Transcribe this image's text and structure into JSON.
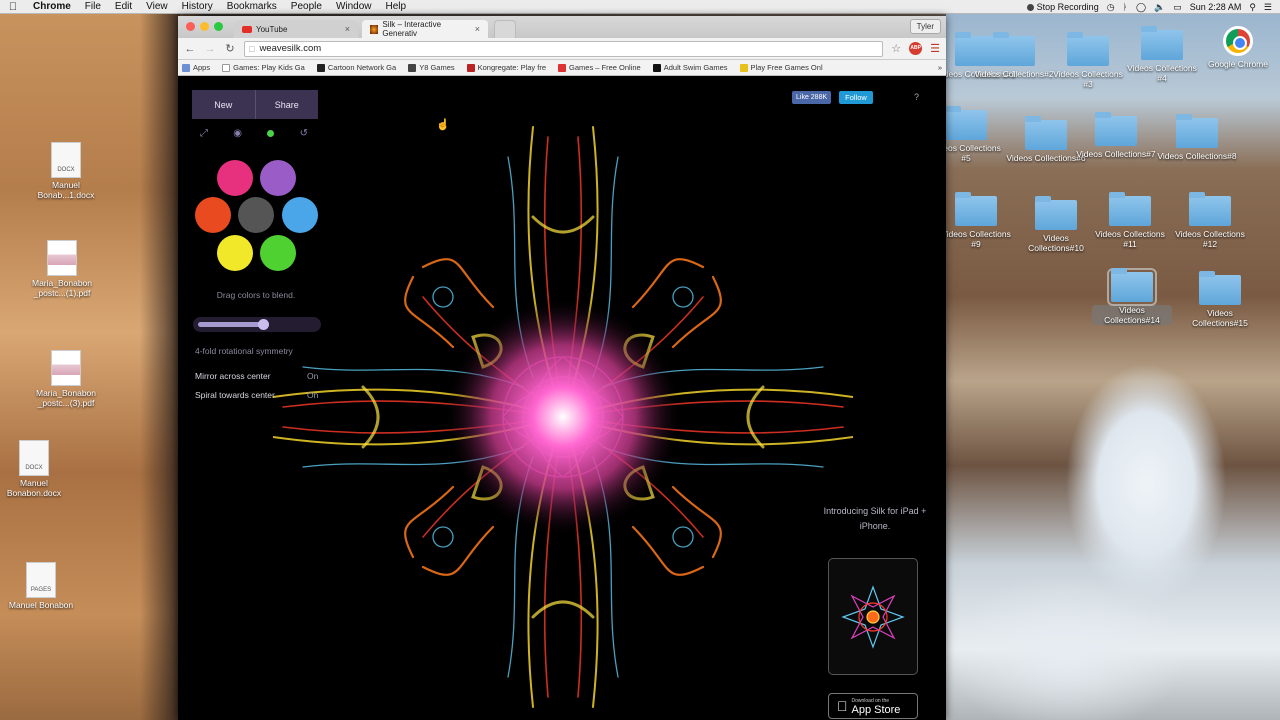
{
  "menubar": {
    "app": "Chrome",
    "items": [
      "File",
      "Edit",
      "View",
      "History",
      "Bookmarks",
      "People",
      "Window",
      "Help"
    ],
    "status": "Stop Recording",
    "clock": "Sun 2:28 AM"
  },
  "desktop": {
    "left_files": [
      {
        "label": "Manuel Bonab...1.docx",
        "type": "DOCX"
      },
      {
        "label": "Maria_Bonabon _postc...(1).pdf",
        "type": ""
      },
      {
        "label": "Maria_Bonabon _postc...(3).pdf",
        "type": ""
      },
      {
        "label": "Manuel Bonabon.docx",
        "type": "DOCX"
      },
      {
        "label": "Manuel Bonabon",
        "type": "PAGES"
      }
    ],
    "folders": [
      {
        "label": "Videos Collections#1"
      },
      {
        "label": "Videos Collections#2"
      },
      {
        "label": "Videos Collections #3"
      },
      {
        "label": "Videos Collections #4"
      },
      {
        "label": "Videos Collections #5"
      },
      {
        "label": "Videos Collections#6"
      },
      {
        "label": "Videos Collections#7"
      },
      {
        "label": "Videos Collections#8"
      },
      {
        "label": "Videos Collections #9"
      },
      {
        "label": "Videos Collections#10"
      },
      {
        "label": "Videos Collections #11"
      },
      {
        "label": "Videos Collections #12"
      },
      {
        "label": "Videos Collections#14"
      },
      {
        "label": "Videos Collections#15"
      }
    ],
    "chrome_icon_label": "Google Chrome"
  },
  "browser": {
    "tabs": [
      {
        "title": "YouTube"
      },
      {
        "title": "Silk – Interactive Generativ"
      }
    ],
    "profile": "Tyler",
    "url": "weavesilk.com",
    "bookmarks": [
      "Apps",
      "Games: Play Kids Ga",
      "Cartoon Network Ga",
      "Y8 Games",
      "Kongregate: Play fre",
      "Games – Free Online",
      "Adult Swim Games",
      "Play Free Games Onl"
    ]
  },
  "silk": {
    "new_label": "New",
    "share_label": "Share",
    "colors": [
      "#e8317e",
      "#9a5cc6",
      "#ea4a1f",
      "#555555",
      "#4aa6e8",
      "#f2e82a",
      "#4fd132"
    ],
    "hint": "Drag colors to blend.",
    "symmetry_label": "4-fold rotational symmetry",
    "symmetry_fraction": 0.55,
    "mirror_label": "Mirror across center",
    "mirror_value": "On",
    "spiral_label": "Spiral towards center",
    "spiral_value": "On",
    "fb_like": "Like 288K",
    "tw_follow": "Follow",
    "help": "?",
    "intro": "Introducing Silk for iPad + iPhone.",
    "appstore_small": "Download on the",
    "appstore_big": "App Store"
  }
}
